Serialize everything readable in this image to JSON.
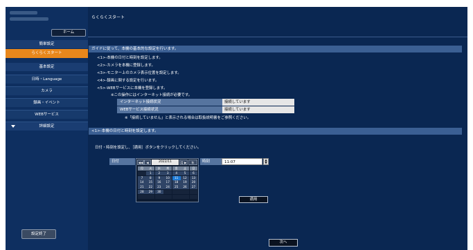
{
  "header": {
    "title": "らくらくスタート"
  },
  "sidebar": {
    "home_label": "ホーム",
    "items": [
      {
        "label": "簡単設定"
      },
      {
        "label": "らくらくスタート"
      },
      {
        "label": "基本設定"
      },
      {
        "label": "日時・Language"
      },
      {
        "label": "カメラ"
      },
      {
        "label": "録画・イベント"
      },
      {
        "label": "WEBサービス"
      },
      {
        "label": "詳細設定"
      }
    ],
    "settings_end_label": "設定終了"
  },
  "guide": {
    "heading": "ガイドに従って、本機の基本的な設定を行います。",
    "steps": [
      "<1>-本機の日付と時刻を設定します。",
      "<2>-カメラを本機に登録します。",
      "<3>-モニター上のカメラ表示位置を設定します。",
      "<4>-録画に関する設定を行います。",
      "<5>-WEBサービスに本機を登録します。"
    ],
    "note": "※この操作にはインターネット接続が必要です。",
    "status_rows": [
      {
        "label": "インターネット接続状況",
        "value": "接続しています"
      },
      {
        "label": "WEBサービス接続状況",
        "value": "接続しています"
      }
    ],
    "status_note": "※「接続していません」と表示される場合は取扱説明書をご参照ください。"
  },
  "datetime": {
    "heading": "<1>-本機の日付と時刻を設定します。",
    "instruction": "日付・時刻を設定し、［適用］ボタンをクリックしてください。",
    "date_label": "日付",
    "time_label": "時刻",
    "time_value": "11:07",
    "calendar": {
      "prev_year": "◀◀ 年",
      "prev_month": "◀ 月",
      "month": "2022/11",
      "next_month": "月 ▶",
      "next_year": "年 ▶▶",
      "weekdays": [
        "月",
        "火",
        "水",
        "木",
        "金",
        "土",
        "日"
      ],
      "weeks": [
        [
          "",
          "1",
          "2",
          "3",
          "4",
          "5",
          "6"
        ],
        [
          "7",
          "8",
          "9",
          "10",
          "11",
          "12",
          "13"
        ],
        [
          "14",
          "15",
          "16",
          "17",
          "18",
          "19",
          "20"
        ],
        [
          "21",
          "22",
          "23",
          "24",
          "25",
          "26",
          "27"
        ],
        [
          "28",
          "29",
          "30",
          "",
          "",
          "",
          ""
        ],
        [
          "",
          "",
          "",
          "",
          "",
          "",
          ""
        ]
      ],
      "selected_day": "11"
    },
    "apply_label": "適用"
  },
  "footer": {
    "next_label": "次へ"
  }
}
